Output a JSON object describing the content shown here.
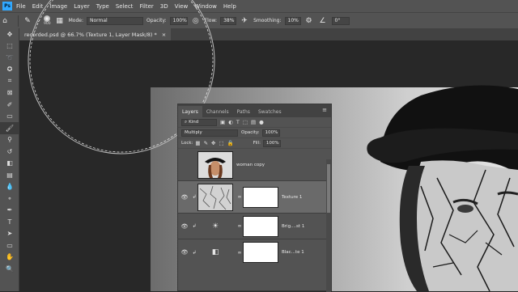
{
  "app": {
    "logo": "Ps"
  },
  "menu": [
    "File",
    "Edit",
    "Image",
    "Layer",
    "Type",
    "Select",
    "Filter",
    "3D",
    "View",
    "Window",
    "Help"
  ],
  "options": {
    "brush_size": "900",
    "mode_label": "Mode:",
    "mode_value": "Normal",
    "opacity_label": "Opacity:",
    "opacity_value": "100%",
    "flow_label": "Flow:",
    "flow_value": "38%",
    "smoothing_label": "Smoothing:",
    "smoothing_value": "10%",
    "angle_value": "0°"
  },
  "document": {
    "tab_title": "recorded.psd @ 66.7% (Texture 1, Layer Mask/8) *",
    "close": "×"
  },
  "layers_panel": {
    "tabs": [
      "Layers",
      "Channels",
      "Paths",
      "Swatches"
    ],
    "filter_kind": "Kind",
    "blend_mode": "Multiply",
    "opacity_label": "Opacity:",
    "opacity_value": "100%",
    "lock_label": "Lock:",
    "fill_label": "Fill:",
    "fill_value": "100%",
    "layers": [
      {
        "name": "woman copy",
        "visible": false,
        "selected": false
      },
      {
        "name": "Texture 1",
        "visible": true,
        "selected": true
      },
      {
        "name": "Brig....st 1",
        "visible": true,
        "selected": false
      },
      {
        "name": "Blac...te 1",
        "visible": true,
        "selected": false
      }
    ]
  },
  "colors": {
    "accent": "#31a8ff",
    "panel": "#535353",
    "canvas": "#282828"
  }
}
